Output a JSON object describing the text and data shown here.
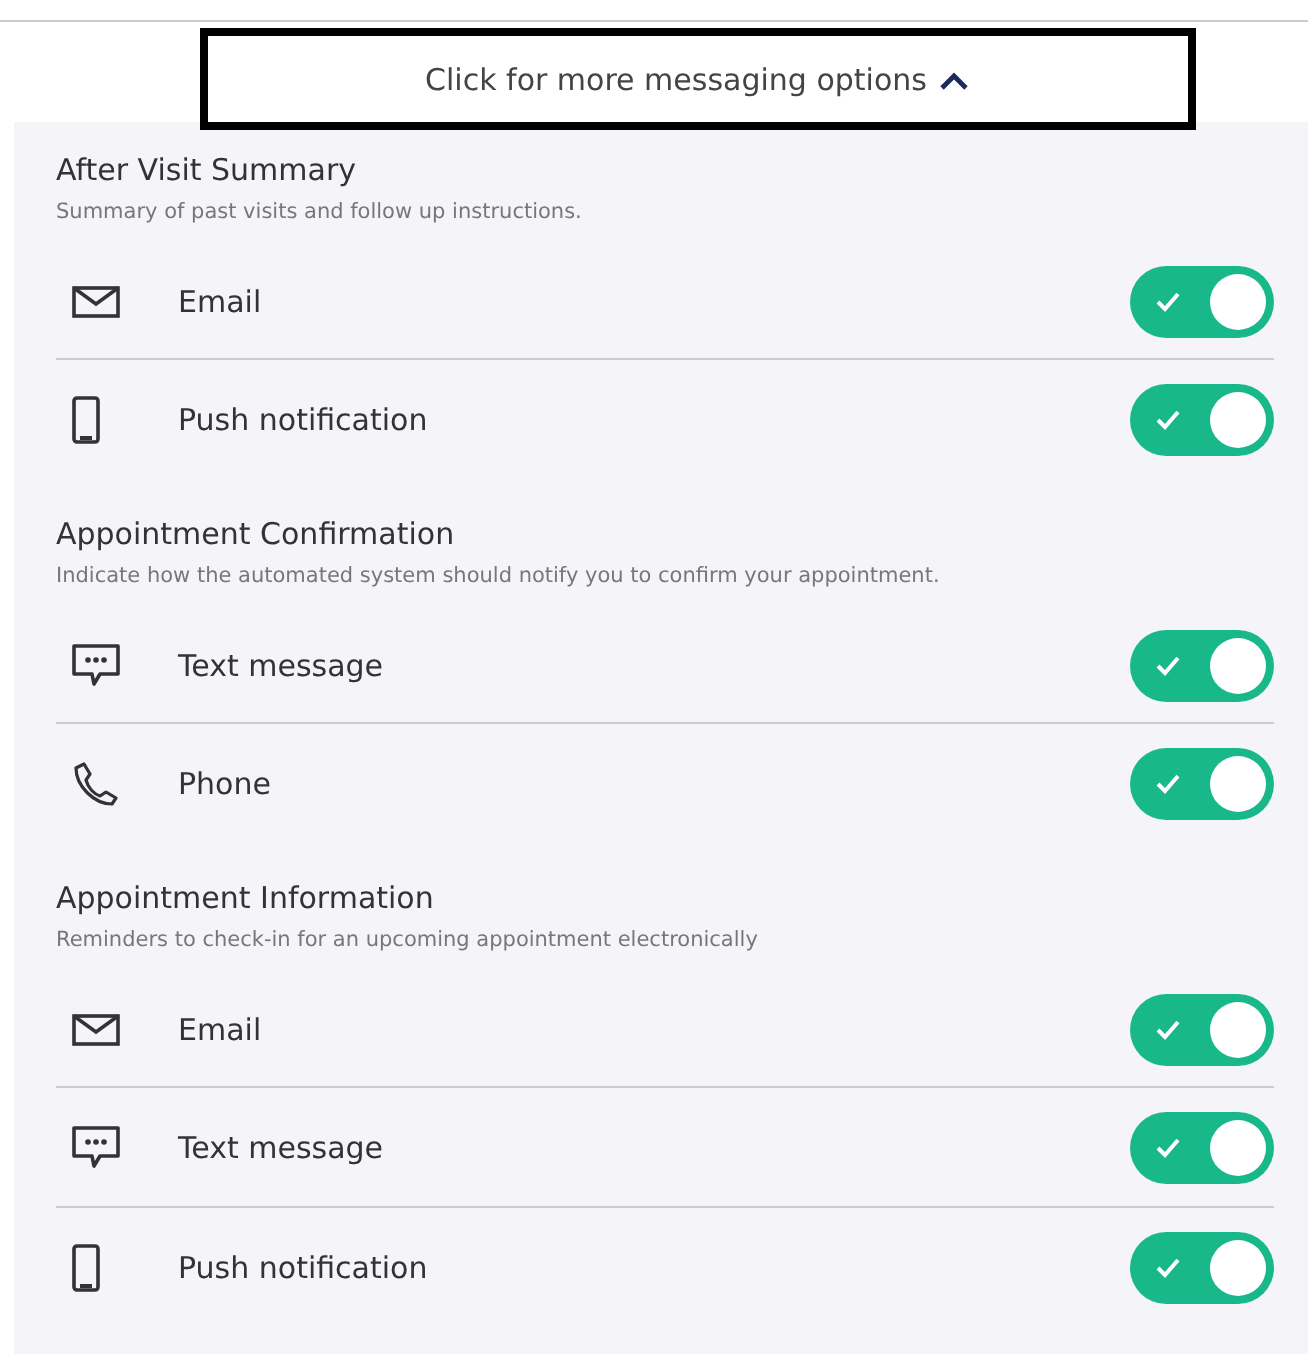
{
  "header_button": {
    "label": "Click for more messaging options",
    "expanded": true
  },
  "sections": [
    {
      "title": "After Visit Summary",
      "description": "Summary of past visits and follow up instructions.",
      "channels": [
        {
          "kind": "email",
          "label": "Email",
          "on": true
        },
        {
          "kind": "mobile",
          "label": "Push notification",
          "on": true
        }
      ]
    },
    {
      "title": "Appointment Confirmation",
      "description": "Indicate how the automated system should notify you to confirm your appointment.",
      "channels": [
        {
          "kind": "chat",
          "label": "Text message",
          "on": true
        },
        {
          "kind": "phone",
          "label": "Phone",
          "on": true
        }
      ]
    },
    {
      "title": "Appointment Information",
      "description": "Reminders to check-in for an upcoming appointment electronically",
      "channels": [
        {
          "kind": "email",
          "label": "Email",
          "on": true
        },
        {
          "kind": "chat",
          "label": "Text message",
          "on": true
        },
        {
          "kind": "mobile",
          "label": "Push notification",
          "on": true
        }
      ]
    }
  ]
}
